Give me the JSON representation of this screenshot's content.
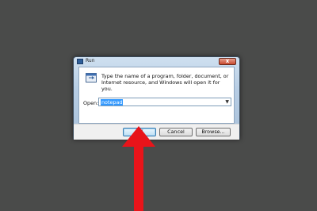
{
  "dialog": {
    "title": "Run",
    "close_label": "x",
    "description": "Type the name of a program, folder, document, or Internet resource, and Windows will open it for you.",
    "open_label": "Open:",
    "open_value": "notepad",
    "ok_label": "OK",
    "cancel_label": "Cancel",
    "browse_label": "Browse..."
  },
  "annotation": {
    "arrow_color": "#e8141a"
  }
}
